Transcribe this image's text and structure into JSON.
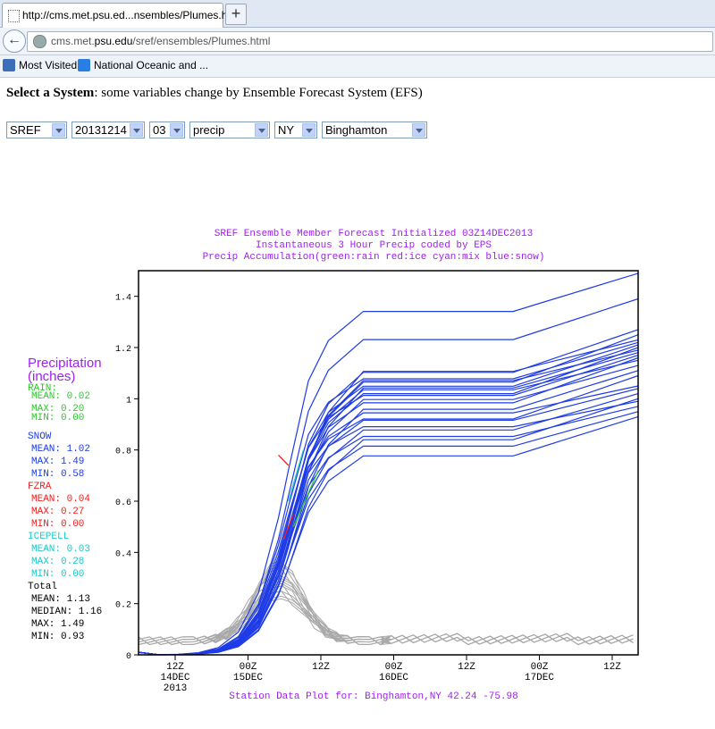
{
  "browser": {
    "tab_title": "http://cms.met.psu.ed...nsembles/Plumes.html",
    "url_prefix": "cms.met.",
    "url_domain": "psu.edu",
    "url_path": "/sref/ensembles/Plumes.html",
    "bookmarks": [
      "Most Visited",
      "National Oceanic and ..."
    ]
  },
  "page": {
    "heading_bold": "Select a System",
    "heading_rest": ": some variables change by Ensemble Forecast System (EFS)",
    "selects": [
      "SREF",
      "20131214",
      "03",
      "precip",
      "NY",
      "Binghamton"
    ]
  },
  "chart_data": {
    "type": "line",
    "title": [
      "SREF Ensemble Member Forecast Initialized 03Z14DEC2013",
      "Instantaneous 3 Hour Precip coded by EPS",
      "Precip Accumulation(green:rain red:ice cyan:mix blue:snow)"
    ],
    "footer": "Station Data Plot for: Binghamton,NY 42.24 -75.98",
    "ylim": [
      0,
      1.5
    ],
    "yticks": [
      "1.4",
      "1.2",
      "1",
      "0.8",
      "0.6",
      "0.4",
      "0.2",
      "0"
    ],
    "xticks": [
      [
        "12Z",
        "14DEC",
        "2013"
      ],
      [
        "00Z",
        "15DEC",
        ""
      ],
      [
        "12Z",
        "",
        ""
      ],
      [
        "00Z",
        "16DEC",
        ""
      ],
      [
        "12Z",
        "",
        ""
      ],
      [
        "00Z",
        "17DEC",
        ""
      ],
      [
        "12Z",
        "",
        ""
      ]
    ],
    "colors": {
      "snow": "#1f3ce6",
      "rain": "#2ec82e",
      "ice": "#ee2020",
      "mix": "#20c8c8",
      "bars": "#a8a8a8",
      "title": "#a020f0"
    },
    "legend": {
      "title": [
        "Precipitation",
        "(inches)"
      ],
      "rain": {
        "label": "RAIN:",
        "mean": "MEAN:  0.02",
        "max": "MAX:  0.20",
        "min": "MIN:  0.00"
      },
      "snow": {
        "label": "SNOW",
        "mean": "MEAN: 1.02",
        "max": "MAX:  1.49",
        "min": "MIN:  0.58"
      },
      "fzra": {
        "label": "FZRA",
        "mean": "MEAN: 0.04",
        "max": "MAX: 0.27",
        "min": "MIN: 0.00"
      },
      "icepell": {
        "label": "ICEPELL",
        "mean": "MEAN: 0.03",
        "max": "MAX: 0.28",
        "min": "MIN: 0.00"
      },
      "total": {
        "label": "Total",
        "mean": "MEAN: 1.13",
        "median": "MEDIAN: 1.16",
        "max": "MAX: 1.49",
        "min": "MIN: 0.93"
      }
    },
    "member_finals": [
      1.49,
      1.39,
      1.27,
      1.25,
      1.23,
      1.22,
      1.21,
      1.2,
      1.19,
      1.18,
      1.17,
      1.16,
      1.15,
      1.13,
      1.11,
      1.09,
      1.05,
      1.04,
      1.02,
      1.0,
      0.99,
      0.97,
      0.95,
      0.93
    ]
  }
}
